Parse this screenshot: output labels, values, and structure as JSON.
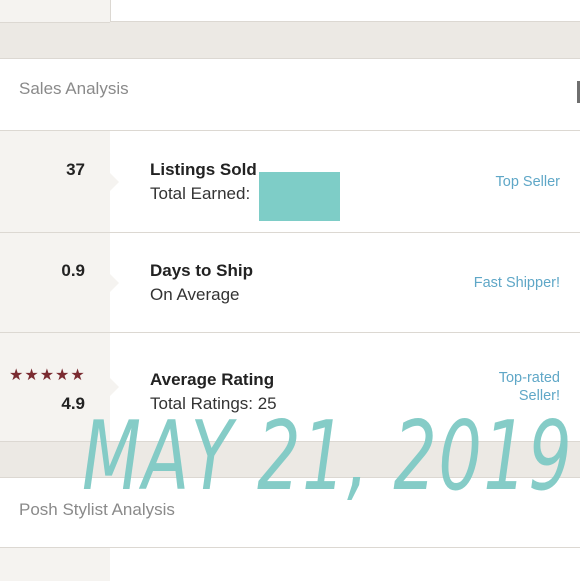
{
  "sales_analysis": {
    "title": "Sales Analysis",
    "rows": [
      {
        "value": "37",
        "title": "Listings Sold",
        "subtitle": "Total Earned:",
        "badge": "Top Seller"
      },
      {
        "value": "0.9",
        "title": "Days to Ship",
        "subtitle": "On Average",
        "badge": "Fast Shipper!"
      },
      {
        "value": "4.9",
        "stars": "★★★★★",
        "title": "Average Rating",
        "subtitle": "Total Ratings: 25",
        "badge_line1": "Top-rated",
        "badge_line2": "Seller!"
      }
    ]
  },
  "posh_stylist": {
    "title": "Posh Stylist Analysis"
  },
  "watermark": {
    "text": "MAY 21, 2019"
  },
  "colors": {
    "badge": "#5fa7c7",
    "stars": "#7a2b31",
    "redaction": "#7ecdc7",
    "watermark": "#7fcac5"
  }
}
